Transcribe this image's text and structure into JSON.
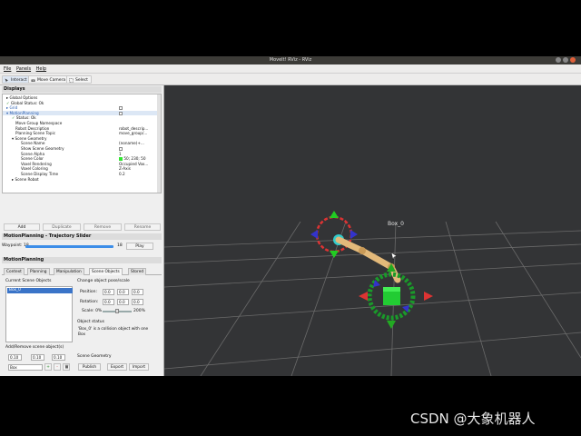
{
  "window": {
    "title": "MoveIt! RViz - RViz"
  },
  "menu": [
    "File",
    "Panels",
    "Help"
  ],
  "toolbar": {
    "interact": "Interact",
    "move_camera": "Move Camera",
    "select": "Select"
  },
  "displays": {
    "title": "Displays",
    "rows": [
      {
        "key": "Global Options",
        "value": ""
      },
      {
        "key": "Global Status: Ok",
        "value": ""
      },
      {
        "key": "Grid",
        "value": ""
      },
      {
        "key": "MotionPlanning",
        "value": ""
      },
      {
        "key": "Status: Ok",
        "value": ""
      },
      {
        "key": "Move Group Namespace",
        "value": ""
      },
      {
        "key": "Robot Description",
        "value": "robot_descrip..."
      },
      {
        "key": "Planning Scene Topic",
        "value": "move_group/..."
      },
      {
        "key": "Scene Geometry",
        "value": ""
      },
      {
        "key": "Scene Name",
        "value": "(noname)+..."
      },
      {
        "key": "Show Scene Geometry",
        "value": ""
      },
      {
        "key": "Scene Alpha",
        "value": "1"
      },
      {
        "key": "Scene Color",
        "value": "50; 230; 50"
      },
      {
        "key": "Voxel Rendering",
        "value": "Occupied Vox..."
      },
      {
        "key": "Voxel Coloring",
        "value": "Z-Axis"
      },
      {
        "key": "Scene Display Time",
        "value": "0.2"
      },
      {
        "key": "Scene Robot",
        "value": ""
      }
    ]
  },
  "display_buttons": {
    "add": "Add",
    "duplicate": "Duplicate",
    "remove": "Remove",
    "rename": "Rename"
  },
  "trajectory": {
    "title": "MotionPlanning - Trajectory Slider",
    "waypoint_label": "Waypoint:",
    "waypoint_value": "18",
    "waypoint_max": "18",
    "play": "Play",
    "slider_fraction": 1.0
  },
  "motion_planning": {
    "title": "MotionPlanning",
    "tabs": [
      "Context",
      "Planning",
      "Manipulation",
      "Scene Objects",
      "Stored"
    ],
    "active_tab": "Scene Objects",
    "current_scene_objects": "Current Scene Objects",
    "objects": [
      "Box_0"
    ],
    "change_pose_label": "Change object pose/scale",
    "position_label": "Position:",
    "position": [
      "0.0",
      "0.0",
      "0.0"
    ],
    "rotation_label": "Rotation:",
    "rotation": [
      "0.0",
      "0.0",
      "0.0"
    ],
    "scale_label": "Scale:",
    "scale_min": "0%",
    "scale_max": "200%",
    "object_status_label": "Object status",
    "object_status": "'Box_0' is a collision object with one Box",
    "add_remove_label": "Add/Remove scene object(s)",
    "size": [
      "0.10",
      "0.10",
      "0.10"
    ],
    "shape": "Box",
    "plus": "+",
    "minus": "-",
    "scene_geometry_label": "Scene Geometry",
    "publish": "Publish",
    "export": "Export",
    "import": "Import"
  },
  "viewport": {
    "object_label": "Box_0"
  },
  "watermark": "CSDN @大象机器人",
  "colors": {
    "viewport_bg": "#333436",
    "scene_object": "#22cc33",
    "selection_blue": "#3a74c8",
    "robot_arm": "#e3b97a"
  }
}
